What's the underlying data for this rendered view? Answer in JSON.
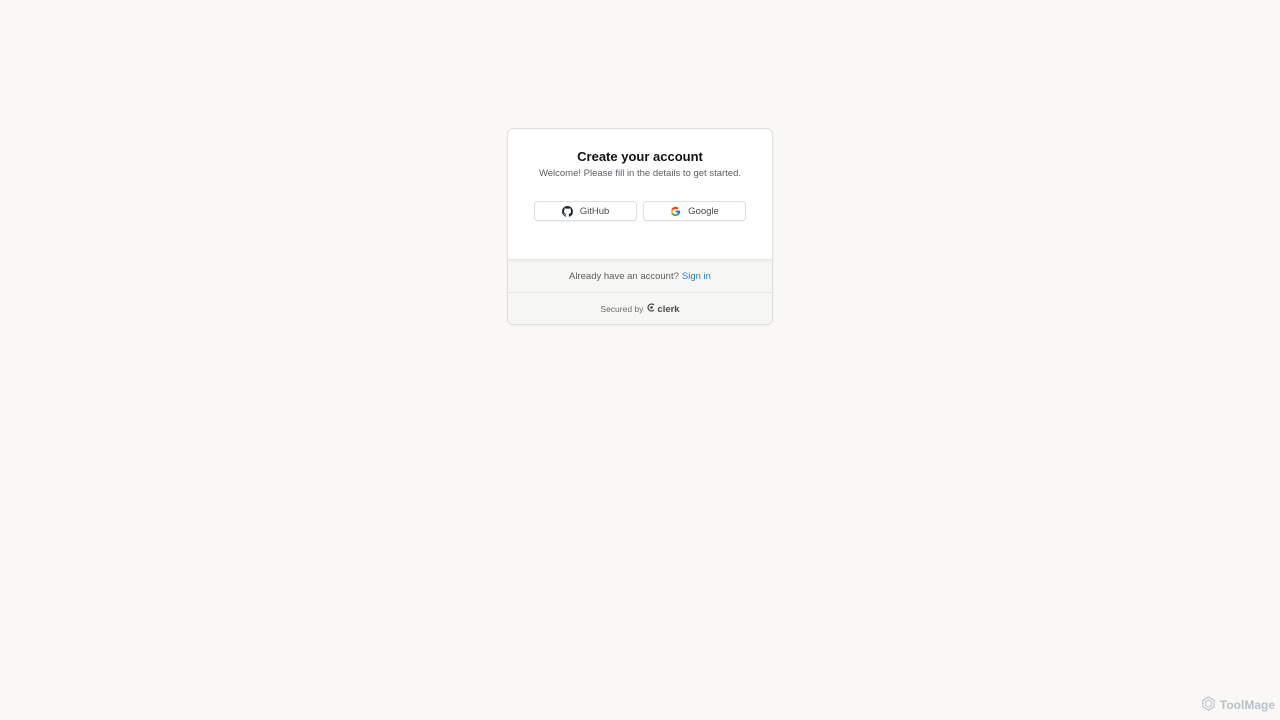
{
  "card": {
    "title": "Create your account",
    "subtitle": "Welcome! Please fill in the details to get started.",
    "social": [
      {
        "label": "GitHub",
        "icon": "github-icon"
      },
      {
        "label": "Google",
        "icon": "google-icon"
      }
    ],
    "signin_prompt": "Already have an account?",
    "signin_link": "Sign in",
    "secured_by": "Secured by",
    "brand": "clerk"
  },
  "watermark": {
    "label": "ToolMage",
    "icon": "toolmage-logo-icon"
  },
  "colors": {
    "background": "#f9f8f6",
    "link": "#2f7fbf",
    "card": "#ffffff",
    "footer": "#f6f6f5"
  }
}
